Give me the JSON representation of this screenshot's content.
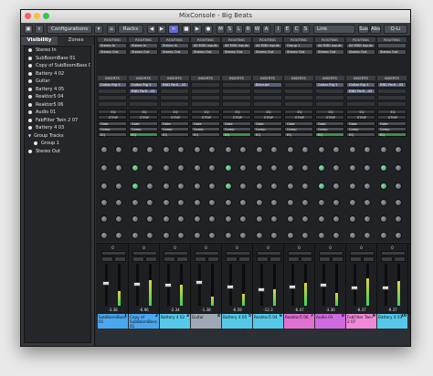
{
  "window": {
    "title": "MixConsole - Big Beats",
    "traffic_lights": [
      "#fc605c",
      "#fdbc40",
      "#34c84a"
    ]
  },
  "toolbar": {
    "configurations_label": "Configurations",
    "racks_label": "Racks",
    "link_label": "Link",
    "sus_label": "Sus",
    "abs_label": "Abs",
    "q_link_label": "Q-Li",
    "state_buttons": [
      "M",
      "S",
      "L",
      "R",
      "W",
      "A"
    ],
    "io_buttons": [
      "I",
      "E",
      "C",
      "S"
    ],
    "icons": [
      "save-icon",
      "search-icon",
      "configurations-icon",
      "rack-icon",
      "left-arrow-icon",
      "right-arrow-icon",
      "link-icon"
    ]
  },
  "left_panel": {
    "tabs": [
      "Visibility",
      "Zones"
    ],
    "tracks": [
      {
        "label": "Stereo In"
      },
      {
        "label": "SubBoomBass 01"
      },
      {
        "label": "Copy of SubBoomBass 01"
      },
      {
        "label": "Battery 4 02"
      },
      {
        "label": "Guitar"
      },
      {
        "label": "Battery 4 05"
      },
      {
        "label": "Reaktor5 04"
      },
      {
        "label": "Reaktor5 06"
      },
      {
        "label": "Audio 01"
      },
      {
        "label": "FabFilter Twin 2 07"
      },
      {
        "label": "Battery 4 03"
      },
      {
        "label": "Group Tracks",
        "expander": "collapse"
      },
      {
        "label": "Group 1"
      },
      {
        "label": "Stereo Out"
      }
    ]
  },
  "rack": {
    "routing_label": "ROUTING",
    "inserts_label": "INSERTS",
    "eq_label": "EQ",
    "strip_label": "STRIP",
    "gate_label": "Gate",
    "comp_label": "Comp",
    "channel_routing": [
      {
        "in": "Stereo In",
        "out": "Stereo Out"
      },
      {
        "in": "Stereo In",
        "out": "Stereo Out"
      },
      {
        "in": "Stereo In",
        "out": "Stereo Out"
      },
      {
        "in": "All MIDI Inputs",
        "out": "Stereo Out"
      },
      {
        "in": "All MIDI Inputs",
        "out": "Stereo Out"
      },
      {
        "in": "All MIDI Inputs",
        "out": "Stereo Out"
      },
      {
        "in": "Group 1",
        "out": "Stereo Out"
      },
      {
        "in": "All MIDI Inputs",
        "out": "Stereo Out"
      },
      {
        "in": "All MIDI Inputs",
        "out": "Stereo Out"
      },
      {
        "in": "",
        "out": "Stereo Out"
      }
    ],
    "inserts": [
      [
        "Guitar Rig 5",
        ""
      ],
      [
        "Guitar Rig 5",
        "RND Portl...43"
      ],
      [
        "RND Portl...43",
        ""
      ],
      [
        "",
        ""
      ],
      [
        "",
        ""
      ],
      [
        "Bitcrush",
        ""
      ],
      [
        "",
        ""
      ],
      [
        "Guitar Rig 5",
        ""
      ],
      [
        "Guitar Rig 5",
        "RND Portl...43"
      ],
      [
        "RND Portl...43",
        ""
      ]
    ],
    "eq_active": [
      false,
      true,
      false,
      false,
      true,
      false,
      false,
      true,
      false,
      true
    ]
  },
  "faders": {
    "channels": [
      {
        "gain": "-3.38",
        "pan": "0",
        "level": 0.55,
        "meter": 0.35,
        "name": "SubBoomBass 01",
        "num": "1",
        "color": "#4aa8f0"
      },
      {
        "gain": "-6.96",
        "pan": "0",
        "level": 0.52,
        "meter": 0.6,
        "name": "Copy of SubBoomBass 01",
        "num": "2",
        "color": "#4aa8f0"
      },
      {
        "gain": "-2.34",
        "pan": "0",
        "level": 0.5,
        "meter": 0.5,
        "name": "Battery 4 02",
        "num": "3",
        "color": "#57c9e8"
      },
      {
        "gain": "-1.38",
        "pan": "0",
        "level": 0.58,
        "meter": 0.22,
        "name": "Guitar",
        "num": "4",
        "color": "#9ea7b3"
      },
      {
        "gain": "-6.59",
        "pan": "0",
        "level": 0.46,
        "meter": 0.28,
        "name": "Battery 4 05",
        "num": "5",
        "color": "#57c9e8"
      },
      {
        "gain": "-12.3",
        "pan": "0",
        "level": 0.38,
        "meter": 0.4,
        "name": "Reaktor5 04",
        "num": "6",
        "color": "#57c9e8"
      },
      {
        "gain": "-6.47",
        "pan": "0",
        "level": 0.45,
        "meter": 0.55,
        "name": "Reaktor5 06",
        "num": "7",
        "color": "#e070d0"
      },
      {
        "gain": "-3.30",
        "pan": "0",
        "level": 0.5,
        "meter": 0.3,
        "name": "Audio 01",
        "num": "8",
        "color": "#d06ae0"
      },
      {
        "gain": "-8.37",
        "pan": "0",
        "level": 0.44,
        "meter": 0.65,
        "name": "FabFilter Twin 2 07",
        "num": "9",
        "color": "#f08ad8"
      },
      {
        "gain": "-9.37",
        "pan": "0",
        "level": 0.42,
        "meter": 0.58,
        "name": "Battery 4 03",
        "num": "10",
        "color": "#57c9e8"
      }
    ]
  }
}
